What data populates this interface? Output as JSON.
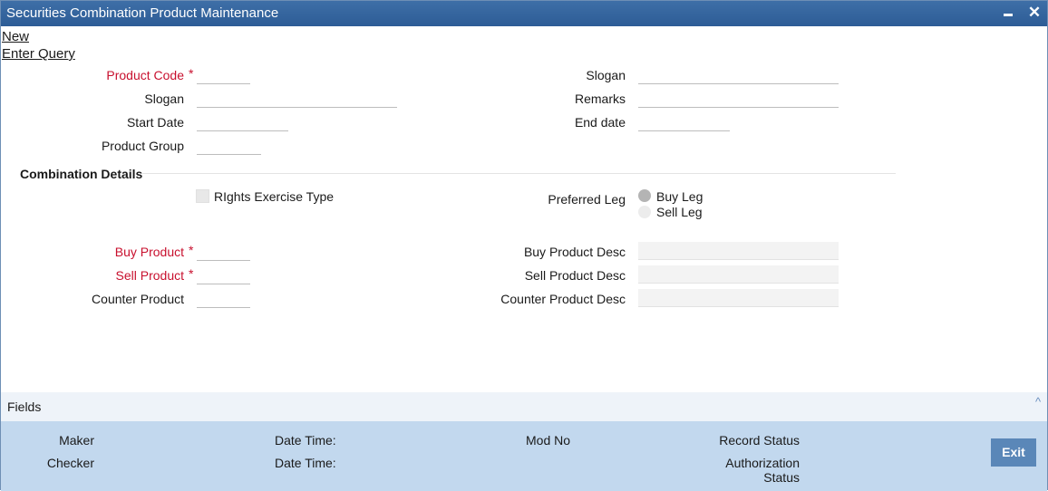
{
  "window": {
    "title": "Securities Combination Product Maintenance",
    "minimize": "▬",
    "close": "✕"
  },
  "menu": {
    "new": "New",
    "enter_query": "Enter Query"
  },
  "form": {
    "product_code": "Product Code",
    "slogan_left": "Slogan",
    "start_date": "Start Date",
    "product_group": "Product Group",
    "slogan_right": "Slogan",
    "remarks": "Remarks",
    "end_date": "End date",
    "required_marker": "*"
  },
  "combination": {
    "title": "Combination Details",
    "rights_exercise_type": "RIghts Exercise Type",
    "preferred_leg": "Preferred Leg",
    "buy_leg": "Buy Leg",
    "sell_leg": "Sell Leg",
    "buy_product": "Buy Product",
    "sell_product": "Sell Product",
    "counter_product": "Counter Product",
    "buy_product_desc": "Buy Product Desc",
    "sell_product_desc": "Sell Product Desc",
    "counter_product_desc": "Counter Product Desc"
  },
  "fields_bar": {
    "label": "Fields",
    "caret": "^"
  },
  "footer": {
    "maker": "Maker",
    "checker": "Checker",
    "date_time_1": "Date Time:",
    "date_time_2": "Date Time:",
    "mod_no": "Mod No",
    "record_status": "Record Status",
    "authorization": "Authorization",
    "status": "Status",
    "exit": "Exit"
  }
}
